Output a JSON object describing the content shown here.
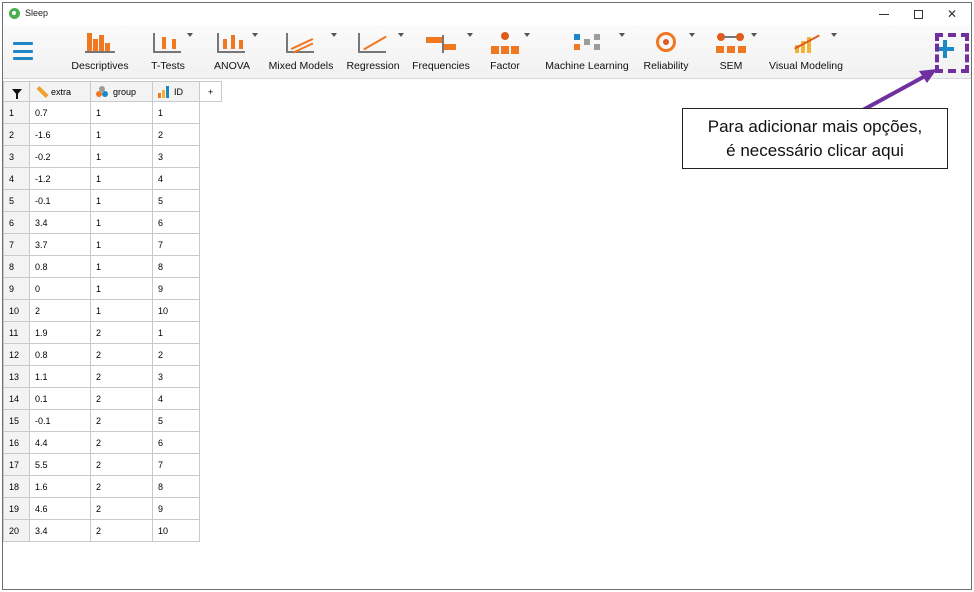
{
  "window": {
    "title": "Sleep"
  },
  "ribbon": {
    "tools": [
      {
        "id": "descriptives",
        "label": "Descriptives",
        "has_menu": false
      },
      {
        "id": "t-tests",
        "label": "T-Tests",
        "has_menu": true
      },
      {
        "id": "anova",
        "label": "ANOVA",
        "has_menu": true
      },
      {
        "id": "mixed-models",
        "label": "Mixed Models",
        "has_menu": true
      },
      {
        "id": "regression",
        "label": "Regression",
        "has_menu": true
      },
      {
        "id": "frequencies",
        "label": "Frequencies",
        "has_menu": true
      },
      {
        "id": "factor",
        "label": "Factor",
        "has_menu": true
      },
      {
        "id": "machine-learning",
        "label": "Machine Learning",
        "has_menu": true
      },
      {
        "id": "reliability",
        "label": "Reliability",
        "has_menu": true
      },
      {
        "id": "sem",
        "label": "SEM",
        "has_menu": true
      },
      {
        "id": "visual-modeling",
        "label": "Visual Modeling",
        "has_menu": true
      }
    ],
    "add_module_icon": "plus-icon"
  },
  "grid": {
    "columns": [
      {
        "name": "extra",
        "type": "scale"
      },
      {
        "name": "group",
        "type": "nominal"
      },
      {
        "name": "ID",
        "type": "ordinal"
      }
    ],
    "rows": [
      [
        "1",
        "0.7",
        "1",
        "1"
      ],
      [
        "2",
        "-1.6",
        "1",
        "2"
      ],
      [
        "3",
        "-0.2",
        "1",
        "3"
      ],
      [
        "4",
        "-1.2",
        "1",
        "4"
      ],
      [
        "5",
        "-0.1",
        "1",
        "5"
      ],
      [
        "6",
        "3.4",
        "1",
        "6"
      ],
      [
        "7",
        "3.7",
        "1",
        "7"
      ],
      [
        "8",
        "0.8",
        "1",
        "8"
      ],
      [
        "9",
        "0",
        "1",
        "9"
      ],
      [
        "10",
        "2",
        "1",
        "10"
      ],
      [
        "11",
        "1.9",
        "2",
        "1"
      ],
      [
        "12",
        "0.8",
        "2",
        "2"
      ],
      [
        "13",
        "1.1",
        "2",
        "3"
      ],
      [
        "14",
        "0.1",
        "2",
        "4"
      ],
      [
        "15",
        "-0.1",
        "2",
        "5"
      ],
      [
        "16",
        "4.4",
        "2",
        "6"
      ],
      [
        "17",
        "5.5",
        "2",
        "7"
      ],
      [
        "18",
        "1.6",
        "2",
        "8"
      ],
      [
        "19",
        "4.6",
        "2",
        "9"
      ],
      [
        "20",
        "3.4",
        "2",
        "10"
      ]
    ],
    "add_column_glyph": "+"
  },
  "annotation": {
    "line1": "Para adicionar mais opções,",
    "line2": "é necessário clicar aqui",
    "color": "#7030a0"
  },
  "colors": {
    "accent_blue": "#1e88c7",
    "icon_orange": "#f07820"
  }
}
